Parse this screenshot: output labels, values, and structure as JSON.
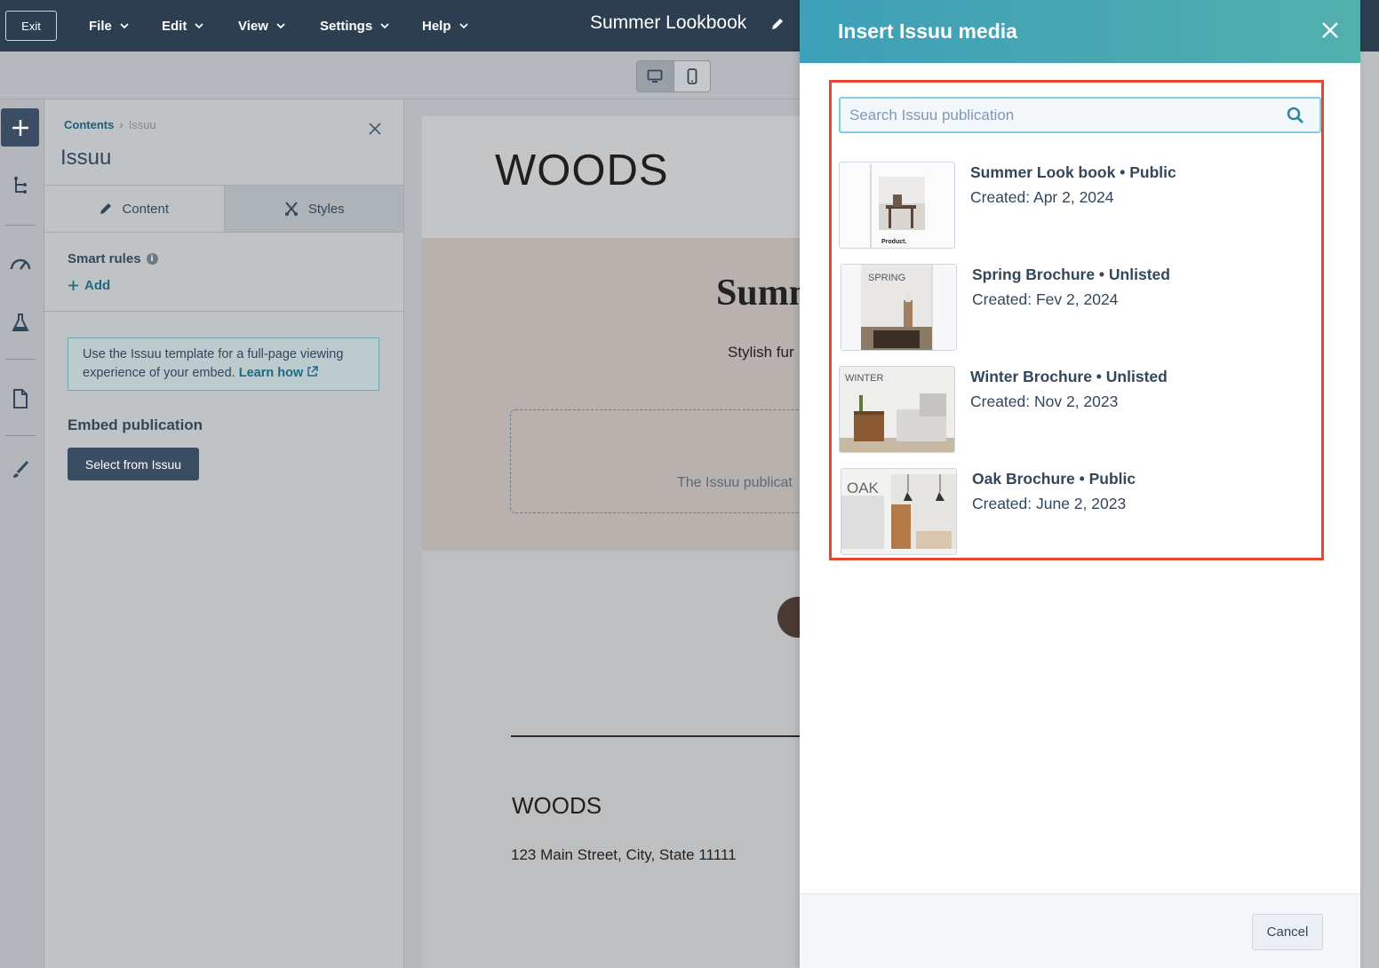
{
  "topbar": {
    "exit_label": "Exit",
    "menus": [
      {
        "label": "File"
      },
      {
        "label": "Edit"
      },
      {
        "label": "View"
      },
      {
        "label": "Settings"
      },
      {
        "label": "Help"
      }
    ],
    "page_title": "Summer Lookbook"
  },
  "sidebar": {
    "breadcrumb": {
      "parent": "Contents",
      "current": "Issuu"
    },
    "title": "Issuu",
    "tabs": [
      {
        "label": "Content"
      },
      {
        "label": "Styles"
      }
    ],
    "smart_rules_label": "Smart rules",
    "add_label": "Add",
    "notice_text": "Use the Issuu template for a full-page viewing experience of your embed.",
    "notice_link": "Learn how",
    "embed_label": "Embed publication",
    "select_button": "Select from Issuu"
  },
  "preview": {
    "brand": "WOODS",
    "hero_title": "Summ",
    "hero_subtitle": "Stylish fur",
    "embed_placeholder": "The Issuu publicat",
    "footer_brand": "WOODS",
    "footer_address": "123 Main Street, City, State 11111"
  },
  "modal": {
    "title": "Insert Issuu media",
    "search_placeholder": "Search Issuu publication",
    "publications": [
      {
        "name": "Summer Look book • Public",
        "created": "Created: Apr 2, 2024",
        "thumb_label": "Product."
      },
      {
        "name": "Spring Brochure • Unlisted",
        "created": "Created: Fev 2, 2024",
        "thumb_label": "SPRING"
      },
      {
        "name": "Winter Brochure • Unlisted",
        "created": "Created: Nov 2, 2023",
        "thumb_label": "WINTER"
      },
      {
        "name": "Oak Brochure • Public",
        "created": "Created: June 2, 2023",
        "thumb_label": "OAK"
      }
    ],
    "cancel_label": "Cancel"
  },
  "colors": {
    "topbar": "#2d3e50",
    "modal_header_start": "#3d9fb8",
    "modal_header_end": "#52b0ad",
    "highlight": "#e8452f",
    "link": "#1d6a85",
    "dark_button": "#3a4d62"
  },
  "icons": [
    "chevron-down-icon",
    "pencil-icon",
    "desktop-icon",
    "mobile-icon",
    "plus-icon",
    "tree-icon",
    "gauge-icon",
    "flask-icon",
    "file-icon",
    "brush-icon",
    "close-icon",
    "scissors-icon",
    "info-icon",
    "external-link-icon",
    "search-icon"
  ]
}
